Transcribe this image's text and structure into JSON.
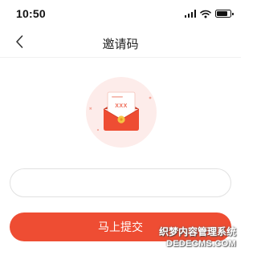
{
  "status_bar": {
    "time": "10:50",
    "icons": [
      "signal-icon",
      "wifi-icon",
      "battery-icon"
    ]
  },
  "nav": {
    "back_icon": "chevron-left-icon",
    "title": "邀请码"
  },
  "illustration": {
    "icon": "invitation-envelope-icon",
    "letter_text": "XXX",
    "colors": {
      "circle_bg": "#fdecea",
      "envelope": "#ee4d33",
      "letter": "#ffffff",
      "seal": "#f6c544"
    }
  },
  "form": {
    "code_value": "",
    "code_placeholder": "",
    "submit_label": "马上提交"
  },
  "watermark": {
    "line1": "织梦内容管理系统",
    "line2": "DEDECMS.COM"
  },
  "colors": {
    "accent": "#ee4d33",
    "input_border": "#e1e1e1",
    "divider": "#f1f1f1"
  }
}
